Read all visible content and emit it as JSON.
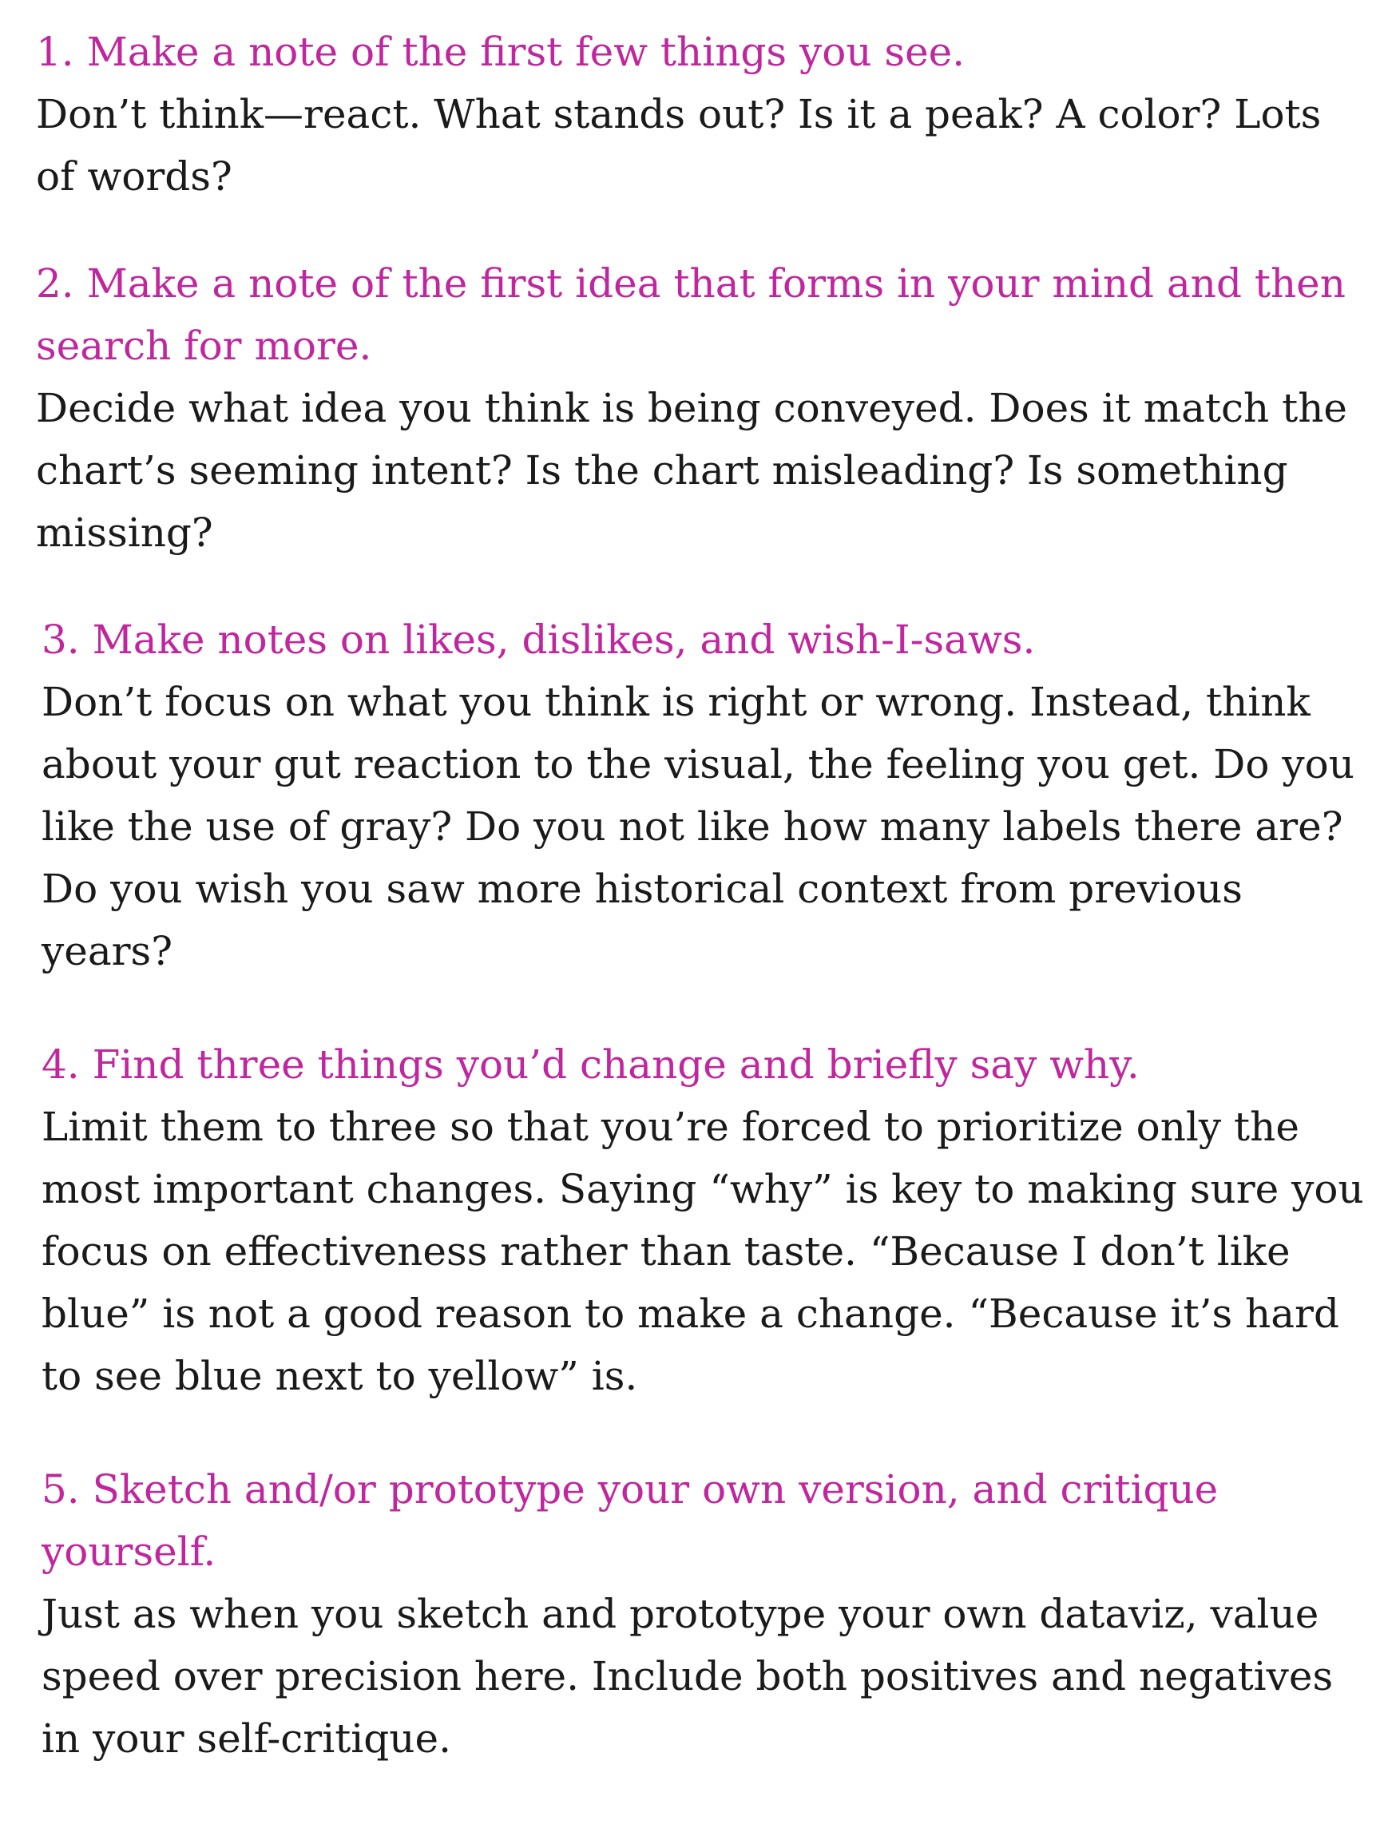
{
  "colors": {
    "heading": "#c0269e",
    "body": "#1a1a1a",
    "background": "#ffffff"
  },
  "items": [
    {
      "heading": "1. Make a note of the first few things you see.",
      "body": "Don’t think—react. What stands out? Is it a peak? A color? Lots\nof words?"
    },
    {
      "heading": "2. Make a note of the first idea that forms in your mind and then\nsearch for more.",
      "body": "Decide what idea you think is being conveyed. Does it match the\nchart’s seeming intent? Is the chart misleading? Is something\n missing?"
    },
    {
      "heading": "3. Make notes on likes, dislikes, and wish-I-saws.",
      "body": "Don’t focus on what you think is right or wrong. Instead, think\nabout your gut reaction to the visual, the feeling you get. Do you\nlike the use of gray? Do you not like how many labels there are?\nDo you wish you saw more historical context from previous\nyears?"
    },
    {
      "heading": "4. Find three things you’d change and briefly say why.",
      "body": "Limit them to three so that you’re forced to prioritize only the\nmost important changes. Saying “why” is key to making sure you\nfocus on effectiveness rather than taste. “Because I don’t like\nblue” is not a good reason to make a change. “Because it’s hard\nto see blue next to yellow” is."
    },
    {
      "heading": "5. Sketch and/or prototype your own version, and critique\nyourself.",
      "body": "Just as when you sketch and prototype your own dataviz, value\nspeed over precision here. Include both positives and negatives\nin your self-critique."
    }
  ]
}
